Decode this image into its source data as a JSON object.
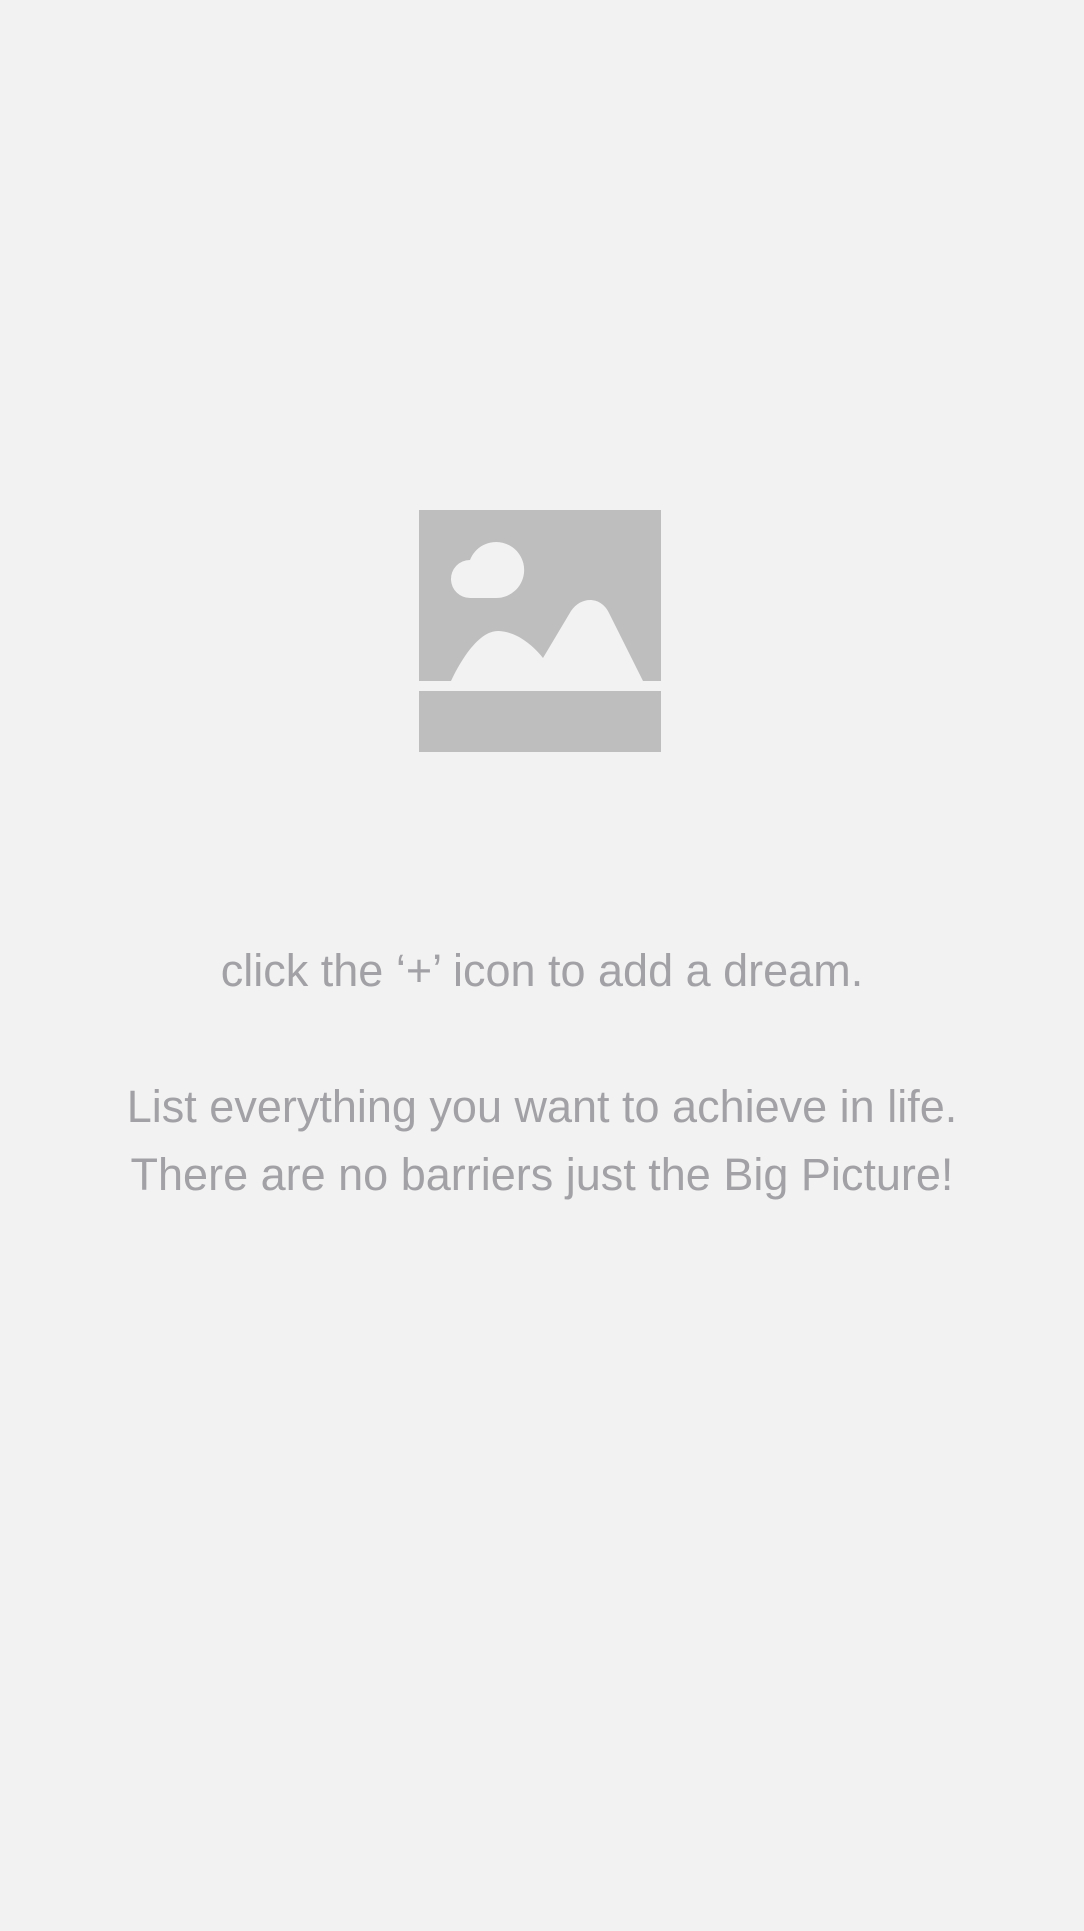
{
  "empty_state": {
    "icon": "image-placeholder-icon",
    "icon_color": "#bdbebd",
    "background_color": "#f2f2f2",
    "text_color": "#a2a2a6",
    "primary_hint": "click the ‘+’ icon to add a dream.",
    "secondary_hint_line1": "List everything you want to achieve in life.",
    "secondary_hint_line2": "There are no barriers just the Big Picture!"
  }
}
